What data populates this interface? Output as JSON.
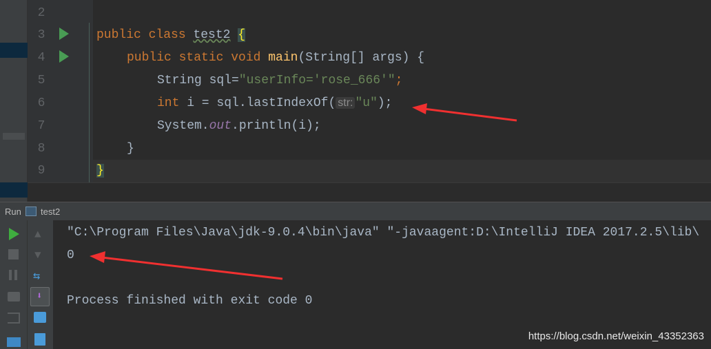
{
  "editor": {
    "lines": [
      {
        "num": "2"
      },
      {
        "num": "3",
        "tokens": [
          "public",
          " class ",
          "test2",
          " ",
          "{"
        ]
      },
      {
        "num": "4",
        "tokens": [
          "public static void ",
          "main",
          "(String[] args) {"
        ]
      },
      {
        "num": "5",
        "tokens": [
          "String sql=",
          "\"userInfo='rose_666'\"",
          ";"
        ]
      },
      {
        "num": "6",
        "tokens": [
          "int",
          " i = sql.lastIndexOf(",
          "str:",
          "\"u\"",
          ");"
        ]
      },
      {
        "num": "7",
        "tokens": [
          "System.",
          "out",
          ".println(i);"
        ]
      },
      {
        "num": "8",
        "tokens": [
          "}"
        ]
      },
      {
        "num": "9",
        "tokens": [
          "}"
        ]
      }
    ]
  },
  "run_panel": {
    "label": "Run",
    "config": "test2"
  },
  "console": {
    "lines": [
      "\"C:\\Program Files\\Java\\jdk-9.0.4\\bin\\java\" \"-javaagent:D:\\IntelliJ IDEA 2017.2.5\\lib\\",
      "0",
      "",
      "Process finished with exit code 0"
    ]
  },
  "watermark": "https://blog.csdn.net/weixin_43352363",
  "colors": {
    "keyword": "#cc7832",
    "string": "#6a8759",
    "method": "#ffc66d",
    "arrow": "#f03030",
    "run": "#499c54"
  }
}
